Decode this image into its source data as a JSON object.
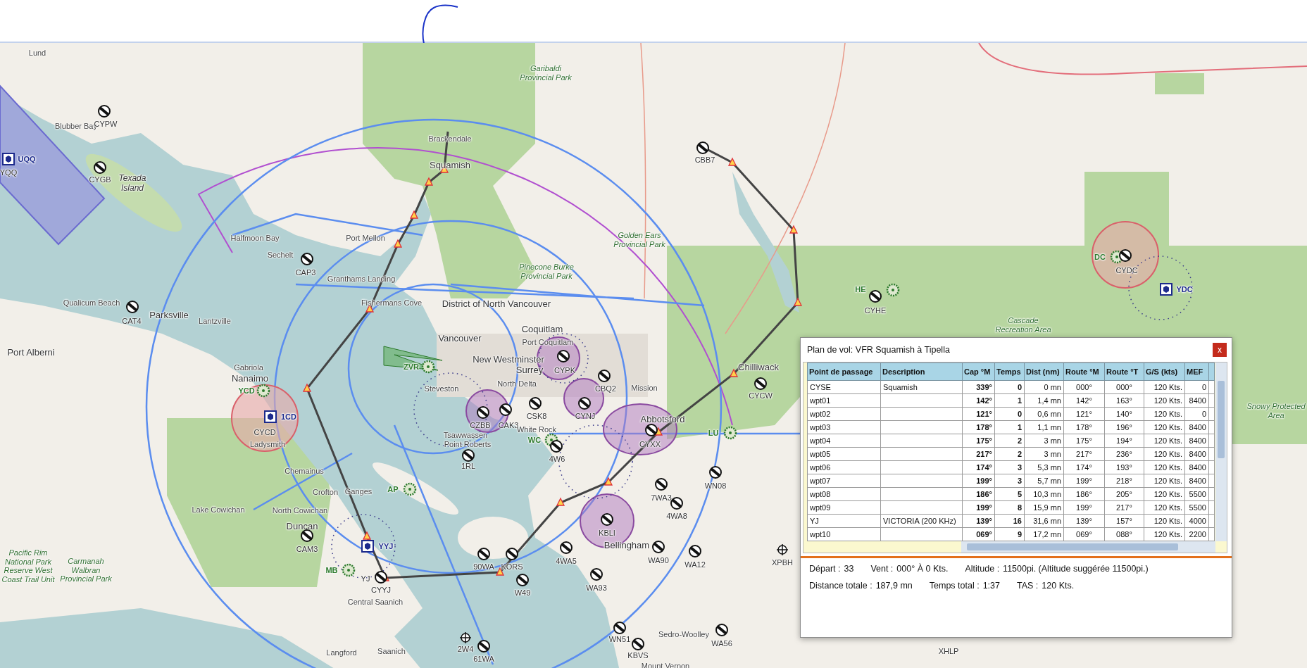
{
  "map": {
    "labels": [
      {
        "text": "Lund",
        "kind": "place"
      },
      {
        "text": "Blubber Bay",
        "kind": "place"
      },
      {
        "text": "CYPW",
        "kind": "airport"
      },
      {
        "text": "UQQ",
        "kind": "navaid"
      },
      {
        "text": "YQQ",
        "kind": "code"
      },
      {
        "text": "CYGB",
        "kind": "airport"
      },
      {
        "text": "Texada Island",
        "kind": "island"
      },
      {
        "text": "Garibaldi Provincial Park",
        "kind": "park"
      },
      {
        "text": "Brackendale",
        "kind": "place"
      },
      {
        "text": "Squamish",
        "kind": "town"
      },
      {
        "text": "CBB7",
        "kind": "airport"
      },
      {
        "text": "Halfmoon Bay",
        "kind": "place"
      },
      {
        "text": "Sechelt",
        "kind": "place"
      },
      {
        "text": "Port Mellon",
        "kind": "place"
      },
      {
        "text": "CAP3",
        "kind": "airport"
      },
      {
        "text": "Granthams Landing",
        "kind": "place"
      },
      {
        "text": "Pinecone Burke Provincial Park",
        "kind": "park"
      },
      {
        "text": "Golden Ears Provincial Park",
        "kind": "park"
      },
      {
        "text": "Qualicum Beach",
        "kind": "place"
      },
      {
        "text": "Parksville",
        "kind": "town"
      },
      {
        "text": "CAT4",
        "kind": "airport"
      },
      {
        "text": "Lantzville",
        "kind": "place"
      },
      {
        "text": "Port Alberni",
        "kind": "town"
      },
      {
        "text": "Fishermans Cove",
        "kind": "place"
      },
      {
        "text": "District of North Vancouver",
        "kind": "town"
      },
      {
        "text": "Vancouver",
        "kind": "town"
      },
      {
        "text": "Coquitlam",
        "kind": "town"
      },
      {
        "text": "Port Coquitlam",
        "kind": "place"
      },
      {
        "text": "New Westminster",
        "kind": "town"
      },
      {
        "text": "Surrey",
        "kind": "town"
      },
      {
        "text": "CYPK",
        "kind": "airport"
      },
      {
        "text": "CBQ2",
        "kind": "airport"
      },
      {
        "text": "CSK8",
        "kind": "airport"
      },
      {
        "text": "CYNJ",
        "kind": "airport"
      },
      {
        "text": "CZBB",
        "kind": "airport"
      },
      {
        "text": "CAK3",
        "kind": "airport"
      },
      {
        "text": "ZVR",
        "kind": "ndb"
      },
      {
        "text": "Steveston",
        "kind": "place"
      },
      {
        "text": "North Delta",
        "kind": "place"
      },
      {
        "text": "Mission",
        "kind": "place"
      },
      {
        "text": "Chilliwack",
        "kind": "town"
      },
      {
        "text": "CYCW",
        "kind": "airport"
      },
      {
        "text": "CYHE",
        "kind": "airport"
      },
      {
        "text": "HE",
        "kind": "ndb"
      },
      {
        "text": "DC",
        "kind": "ndb"
      },
      {
        "text": "CYDC",
        "kind": "airport"
      },
      {
        "text": "YDC",
        "kind": "navaid"
      },
      {
        "text": "Cascade Recreation Area",
        "kind": "park"
      },
      {
        "text": "Snowy Protected Area",
        "kind": "park"
      },
      {
        "text": "Gabriola",
        "kind": "place"
      },
      {
        "text": "Nanaimo",
        "kind": "town"
      },
      {
        "text": "YCD",
        "kind": "ndb"
      },
      {
        "text": "1CD",
        "kind": "navaid"
      },
      {
        "text": "CYCD",
        "kind": "code"
      },
      {
        "text": "Ladysmith",
        "kind": "place"
      },
      {
        "text": "Abbotsford",
        "kind": "town"
      },
      {
        "text": "CYXX",
        "kind": "airport"
      },
      {
        "text": "Tsawwassen",
        "kind": "place"
      },
      {
        "text": "Point Roberts",
        "kind": "place"
      },
      {
        "text": "1RL",
        "kind": "airport"
      },
      {
        "text": "White Rock",
        "kind": "place"
      },
      {
        "text": "WC",
        "kind": "ndb"
      },
      {
        "text": "4W6",
        "kind": "airport"
      },
      {
        "text": "LU",
        "kind": "ndb"
      },
      {
        "text": "Chemainus",
        "kind": "place"
      },
      {
        "text": "Crofton",
        "kind": "place"
      },
      {
        "text": "Ganges",
        "kind": "place"
      },
      {
        "text": "Lake Cowichan",
        "kind": "place"
      },
      {
        "text": "North Cowichan",
        "kind": "place"
      },
      {
        "text": "Duncan",
        "kind": "town"
      },
      {
        "text": "CAM3",
        "kind": "airport"
      },
      {
        "text": "AP",
        "kind": "ndb"
      },
      {
        "text": "YYJ",
        "kind": "navaid"
      },
      {
        "text": "MB",
        "kind": "ndb"
      },
      {
        "text": "YJ",
        "kind": "code"
      },
      {
        "text": "CYYJ",
        "kind": "airport"
      },
      {
        "text": "Central Saanich",
        "kind": "place"
      },
      {
        "text": "Pacific Rim National Park Reserve West Coast Trail Unit",
        "kind": "park"
      },
      {
        "text": "Carmanah Walbran Provincial Park",
        "kind": "park"
      },
      {
        "text": "KBLI",
        "kind": "airport"
      },
      {
        "text": "Bellingham",
        "kind": "town"
      },
      {
        "text": "WN08",
        "kind": "airport"
      },
      {
        "text": "7WA3",
        "kind": "airport"
      },
      {
        "text": "4WA8",
        "kind": "airport"
      },
      {
        "text": "4WA5",
        "kind": "airport"
      },
      {
        "text": "WA93",
        "kind": "airport"
      },
      {
        "text": "90WA",
        "kind": "airport"
      },
      {
        "text": "KORS",
        "kind": "airport"
      },
      {
        "text": "W49",
        "kind": "airport"
      },
      {
        "text": "WA90",
        "kind": "airport"
      },
      {
        "text": "WA12",
        "kind": "airport"
      },
      {
        "text": "XPBH",
        "kind": "heliport"
      },
      {
        "text": "Sedro-Woolley",
        "kind": "place"
      },
      {
        "text": "WN51",
        "kind": "airport"
      },
      {
        "text": "KBVS",
        "kind": "airport"
      },
      {
        "text": "WA56",
        "kind": "airport"
      },
      {
        "text": "Mount Vernon",
        "kind": "place"
      },
      {
        "text": "Langford",
        "kind": "place"
      },
      {
        "text": "Saanich",
        "kind": "place"
      },
      {
        "text": "2W4",
        "kind": "heliport"
      },
      {
        "text": "61WA",
        "kind": "airport"
      },
      {
        "text": "XHLP",
        "kind": "code"
      }
    ]
  },
  "flight_plan": {
    "title": "Plan de vol: VFR Squamish à Tipella",
    "close": "x",
    "columns": [
      "Point de passage",
      "Description",
      "Cap °M",
      "Temps",
      "Dist (nm)",
      "Route °M",
      "Route °T",
      "G/S (kts)",
      "MEF"
    ],
    "rows": [
      {
        "cells": [
          "CYSE",
          "Squamish",
          "339°",
          "0",
          "0 mn",
          "000°",
          "000°",
          "120 Kts.",
          "0"
        ]
      },
      {
        "cells": [
          "wpt01",
          "",
          "142°",
          "1",
          "1,4 mn",
          "142°",
          "163°",
          "120 Kts.",
          "8400"
        ]
      },
      {
        "cells": [
          "wpt02",
          "",
          "121°",
          "0",
          "0,6 mn",
          "121°",
          "140°",
          "120 Kts.",
          "0"
        ]
      },
      {
        "cells": [
          "wpt03",
          "",
          "178°",
          "1",
          "1,1 mn",
          "178°",
          "196°",
          "120 Kts.",
          "8400"
        ]
      },
      {
        "cells": [
          "wpt04",
          "",
          "175°",
          "2",
          "3 mn",
          "175°",
          "194°",
          "120 Kts.",
          "8400"
        ]
      },
      {
        "cells": [
          "wpt05",
          "",
          "217°",
          "2",
          "3 mn",
          "217°",
          "236°",
          "120 Kts.",
          "8400"
        ]
      },
      {
        "cells": [
          "wpt06",
          "",
          "174°",
          "3",
          "5,3 mn",
          "174°",
          "193°",
          "120 Kts.",
          "8400"
        ]
      },
      {
        "cells": [
          "wpt07",
          "",
          "199°",
          "3",
          "5,7 mn",
          "199°",
          "218°",
          "120 Kts.",
          "8400"
        ]
      },
      {
        "cells": [
          "wpt08",
          "",
          "186°",
          "5",
          "10,3 mn",
          "186°",
          "205°",
          "120 Kts.",
          "5500"
        ]
      },
      {
        "cells": [
          "wpt09",
          "",
          "199°",
          "8",
          "15,9 mn",
          "199°",
          "217°",
          "120 Kts.",
          "5500"
        ]
      },
      {
        "cells": [
          "YJ",
          "VICTORIA (200 KHz)",
          "139°",
          "16",
          "31,6 mn",
          "139°",
          "157°",
          "120 Kts.",
          "4000"
        ]
      },
      {
        "cells": [
          "wpt10",
          "",
          "069°",
          "9",
          "17,2 mn",
          "069°",
          "088°",
          "120 Kts.",
          "2200"
        ]
      }
    ],
    "summary": [
      [
        {
          "label": "Départ :",
          "value": "33"
        },
        {
          "label": "Vent :",
          "value": "000° À 0 Kts."
        },
        {
          "label": "Altitude :",
          "value": "11500pi. (Altitude suggérée 11500pi.)"
        }
      ],
      [
        {
          "label": "Distance totale :",
          "value": "187,9 mn"
        },
        {
          "label": "Temps total :",
          "value": "1:37"
        },
        {
          "label": "TAS :",
          "value": "120 Kts."
        }
      ]
    ]
  }
}
